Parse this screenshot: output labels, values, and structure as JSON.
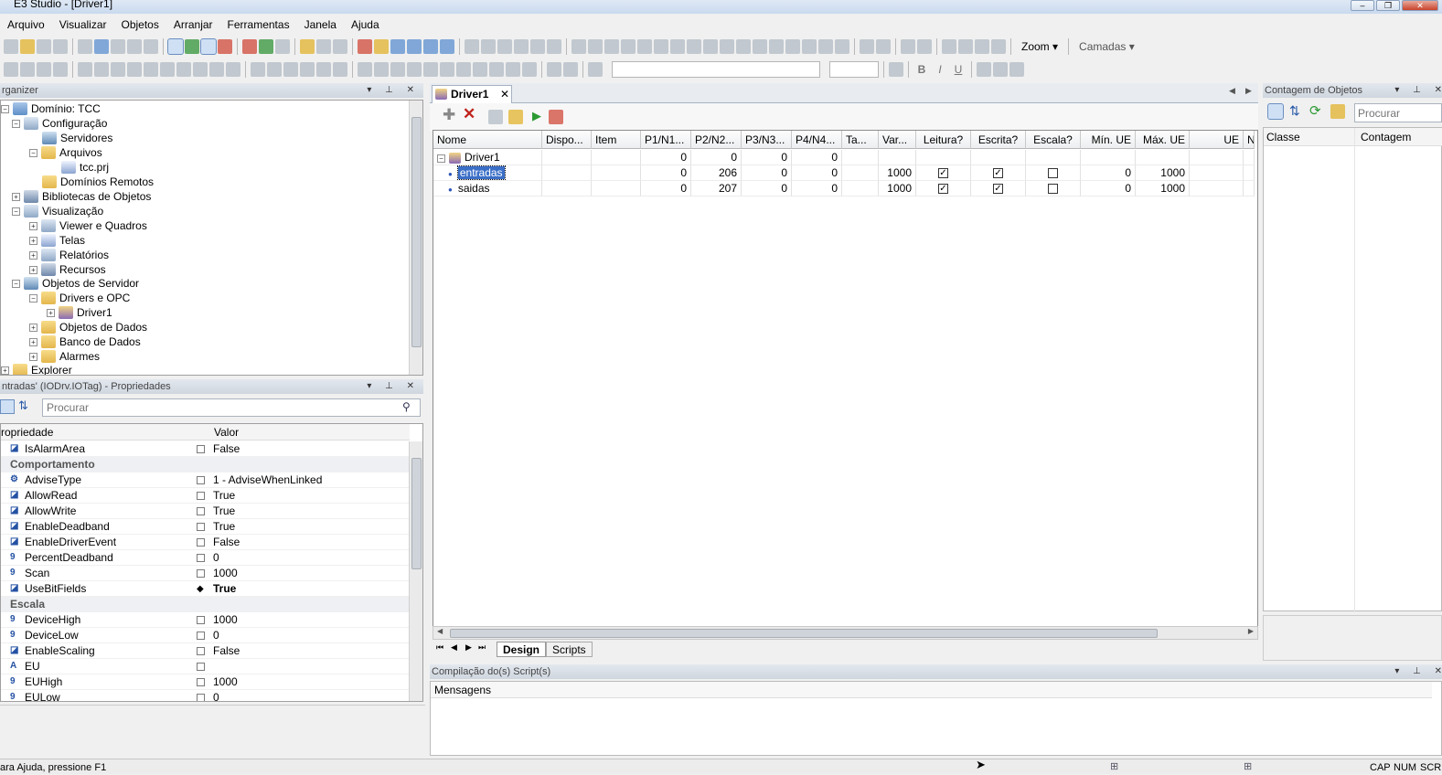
{
  "window": {
    "title": "E3 Studio - [Driver1]"
  },
  "menu": [
    "Arquivo",
    "Visualizar",
    "Objetos",
    "Arranjar",
    "Ferramentas",
    "Janela",
    "Ajuda"
  ],
  "toolbar": {
    "zoom_label": "Zoom",
    "layers_label": "Camadas"
  },
  "organizer": {
    "title": "rganizer",
    "items": [
      {
        "label": "Domínio: TCC"
      },
      {
        "label": "Configuração"
      },
      {
        "label": "Servidores"
      },
      {
        "label": "Arquivos"
      },
      {
        "label": "tcc.prj"
      },
      {
        "label": "Domínios Remotos"
      },
      {
        "label": "Bibliotecas de Objetos"
      },
      {
        "label": "Visualização"
      },
      {
        "label": "Viewer e Quadros"
      },
      {
        "label": "Telas"
      },
      {
        "label": "Relatórios"
      },
      {
        "label": "Recursos"
      },
      {
        "label": "Objetos de Servidor"
      },
      {
        "label": "Drivers e OPC"
      },
      {
        "label": "Driver1"
      },
      {
        "label": "Objetos de Dados"
      },
      {
        "label": "Banco de Dados"
      },
      {
        "label": "Alarmes"
      },
      {
        "label": "Explorer"
      }
    ]
  },
  "properties": {
    "title": "ntradas' (IODrv.IOTag) - Propriedades",
    "search_placeholder": "Procurar",
    "col_property": "ropriedade",
    "col_value": "Valor",
    "rows": [
      {
        "icon": "◪",
        "name": "IsAlarmArea",
        "value": "False"
      },
      {
        "category": "Comportamento"
      },
      {
        "icon": "⚙",
        "name": "AdviseType",
        "value": "1 - AdviseWhenLinked"
      },
      {
        "icon": "◪",
        "name": "AllowRead",
        "value": "True"
      },
      {
        "icon": "◪",
        "name": "AllowWrite",
        "value": "True"
      },
      {
        "icon": "◪",
        "name": "EnableDeadband",
        "value": "True"
      },
      {
        "icon": "◪",
        "name": "EnableDriverEvent",
        "value": "False"
      },
      {
        "icon": "9",
        "name": "PercentDeadband",
        "value": "0"
      },
      {
        "icon": "9",
        "name": "Scan",
        "value": "1000"
      },
      {
        "icon": "◪",
        "name": "UseBitFields",
        "value": "True",
        "bold": true
      },
      {
        "category": "Escala"
      },
      {
        "icon": "9",
        "name": "DeviceHigh",
        "value": "1000"
      },
      {
        "icon": "9",
        "name": "DeviceLow",
        "value": "0"
      },
      {
        "icon": "◪",
        "name": "EnableScaling",
        "value": "False"
      },
      {
        "icon": "A",
        "name": "EU",
        "value": ""
      },
      {
        "icon": "9",
        "name": "EUHigh",
        "value": "1000"
      },
      {
        "icon": "9",
        "name": "EULow",
        "value": "0"
      }
    ]
  },
  "document": {
    "tab_title": "Driver1",
    "columns": [
      "Nome",
      "Dispo...",
      "Item",
      "P1/N1...",
      "P2/N2...",
      "P3/N3...",
      "P4/N4...",
      "Ta...",
      "Var...",
      "Leitura?",
      "Escrita?",
      "Escala?",
      "Mín. UE",
      "Máx. UE",
      "UE",
      "N"
    ],
    "rows": [
      {
        "name": "Driver1",
        "p1": "0",
        "p2": "0",
        "p3": "0",
        "p4": "0",
        "var": "",
        "read": null,
        "write": null,
        "scale": null,
        "min": "",
        "max": ""
      },
      {
        "name": "entradas",
        "p1": "0",
        "p2": "206",
        "p3": "0",
        "p4": "0",
        "var": "1000",
        "read": true,
        "write": true,
        "scale": false,
        "min": "0",
        "max": "1000"
      },
      {
        "name": "saidas",
        "p1": "0",
        "p2": "207",
        "p3": "0",
        "p4": "0",
        "var": "1000",
        "read": true,
        "write": true,
        "scale": false,
        "min": "0",
        "max": "1000"
      }
    ],
    "bottom_tabs": [
      "Design",
      "Scripts"
    ]
  },
  "object_count": {
    "title": "Contagem de Objetos",
    "search_placeholder": "Procurar",
    "col_class": "Classe",
    "col_count": "Contagem"
  },
  "messages": {
    "title": "Compilação do(s) Script(s)",
    "header": "Mensagens"
  },
  "status": {
    "hint": "ara Ajuda, pressione F1",
    "indicators": [
      "CAP",
      "NUM",
      "SCR"
    ]
  }
}
